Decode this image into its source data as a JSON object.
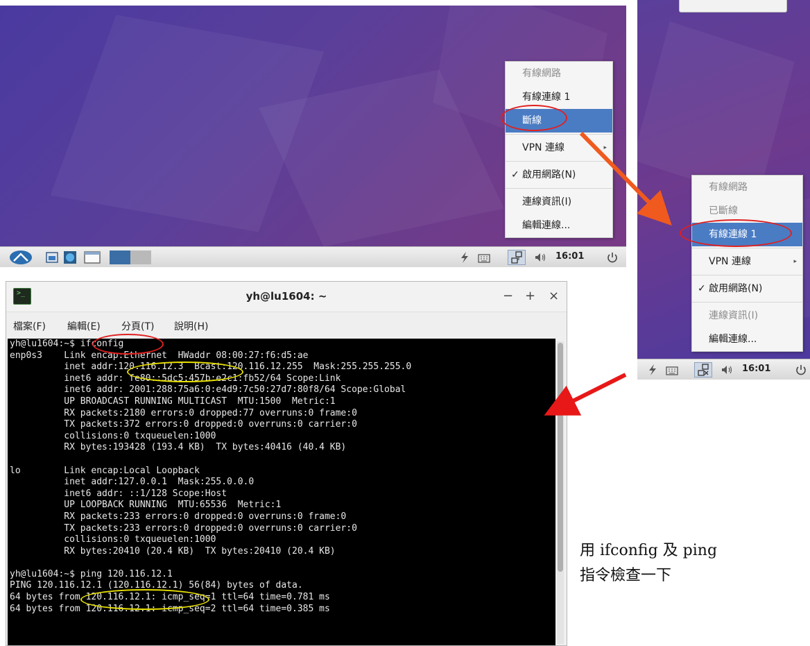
{
  "menu_left": {
    "items": [
      {
        "label": "有線網路",
        "disabled": true
      },
      {
        "label": "有線連線 1"
      },
      {
        "label": "斷線",
        "selected": true
      },
      {
        "label": "VPN 連線",
        "submenu": true
      },
      {
        "label": "啟用網路(N)",
        "checked": true
      },
      {
        "label": "連線資訊(I)"
      },
      {
        "label": "編輯連線..."
      }
    ]
  },
  "menu_right": {
    "items": [
      {
        "label": "有線網路",
        "disabled": true
      },
      {
        "label": "已斷線",
        "disabled": true
      },
      {
        "label": "有線連線 1",
        "selected": true
      },
      {
        "label": "VPN 連線",
        "submenu": true
      },
      {
        "label": "啟用網路(N)",
        "checked": true
      },
      {
        "label": "連線資訊(I)",
        "disabled": true
      },
      {
        "label": "編輯連線..."
      }
    ]
  },
  "taskbar": {
    "clock": "16:01",
    "check_mark": "✓",
    "submenu_arrow": "▸",
    "icons": [
      "start-menu-icon",
      "file-manager-icon",
      "browser-icon",
      "window-icon",
      "workspace-1",
      "workspace-2",
      "bolt-icon",
      "keyboard-icon",
      "network-icon",
      "volume-icon",
      "power-icon"
    ]
  },
  "terminal": {
    "title": "yh@lu1604: ~",
    "icon_glyph": ">_",
    "buttons": {
      "minimize": "−",
      "maximize": "+",
      "close": "×"
    },
    "menu": [
      "檔案(F)",
      "編輯(E)",
      "分頁(T)",
      "說明(H)"
    ],
    "lines": [
      "yh@lu1604:~$ ifconfig",
      "enp0s3    Link encap:Ethernet  HWaddr 08:00:27:f6:d5:ae",
      "          inet addr:120.116.12.3  Bcast:120.116.12.255  Mask:255.255.255.0",
      "          inet6 addr: fe80::5dc5:457b:e2c1:fb52/64 Scope:Link",
      "          inet6 addr: 2001:288:75a6:0:e4d9:7c50:27d7:80f8/64 Scope:Global",
      "          UP BROADCAST RUNNING MULTICAST  MTU:1500  Metric:1",
      "          RX packets:2180 errors:0 dropped:77 overruns:0 frame:0",
      "          TX packets:372 errors:0 dropped:0 overruns:0 carrier:0",
      "          collisions:0 txqueuelen:1000",
      "          RX bytes:193428 (193.4 KB)  TX bytes:40416 (40.4 KB)",
      "",
      "lo        Link encap:Local Loopback",
      "          inet addr:127.0.0.1  Mask:255.0.0.0",
      "          inet6 addr: ::1/128 Scope:Host",
      "          UP LOOPBACK RUNNING  MTU:65536  Metric:1",
      "          RX packets:233 errors:0 dropped:0 overruns:0 frame:0",
      "          TX packets:233 errors:0 dropped:0 overruns:0 carrier:0",
      "          collisions:0 txqueuelen:1000",
      "          RX bytes:20410 (20.4 KB)  TX bytes:20410 (20.4 KB)",
      "",
      "yh@lu1604:~$ ping 120.116.12.1",
      "PING 120.116.12.1 (120.116.12.1) 56(84) bytes of data.",
      "64 bytes from 120.116.12.1: icmp_seq=1 ttl=64 time=0.781 ms",
      "64 bytes from 120.116.12.1: icmp_seq=2 ttl=64 time=0.385 ms"
    ]
  },
  "note": {
    "line1": "用 ifconfig 及 ping",
    "line2": "指令檢查一下"
  },
  "colors": {
    "menu_highlight": "#4a7cc4",
    "annotation_red": "#e02020",
    "annotation_yellow": "#e8e000",
    "arrow_orange": "#f05a1e",
    "arrow_red": "#e81818"
  }
}
